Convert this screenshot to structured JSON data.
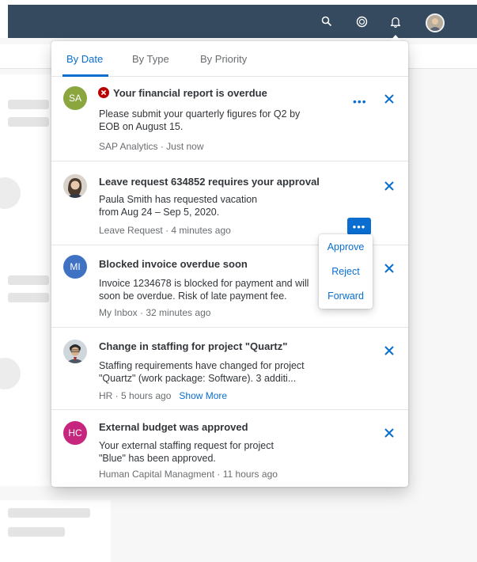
{
  "shellbar": {
    "icons": [
      "search-icon",
      "copilot-icon",
      "bell-icon"
    ],
    "background": "#354a5f"
  },
  "notifications": {
    "tabs": [
      {
        "label": "By Date",
        "active": true
      },
      {
        "label": "By Type",
        "active": false
      },
      {
        "label": "By Priority",
        "active": false
      }
    ],
    "items": [
      {
        "avatar_initials": "SA",
        "avatar_color": "#8ba53f",
        "error_icon": "error-icon",
        "title": "Your financial report is overdue",
        "body_lines": [
          "Please submit your quarterly figures for Q2 by",
          "EOB on August 15."
        ],
        "source": "SAP Analytics",
        "separator": " · ",
        "time": "Just now"
      },
      {
        "avatar_type": "photo",
        "title": "Leave request 634852 requires your approval",
        "body_lines": [
          "Paula Smith has requested vacation",
          "from Aug 24 – Sep 5, 2020."
        ],
        "source": "Leave Request",
        "separator": " · ",
        "time": "4 minutes ago",
        "menu": [
          "Approve",
          "Reject",
          "Forward"
        ]
      },
      {
        "avatar_initials": "MI",
        "avatar_color": "#3f72c2",
        "title": "Blocked invoice overdue soon",
        "body_lines": [
          "Invoice 1234678 is blocked for payment and will",
          "soon be overdue. Risk of late payment fee."
        ],
        "source": "My Inbox",
        "separator": " · ",
        "time": "32 minutes ago"
      },
      {
        "avatar_type": "photo",
        "title": "Change in staffing for project \"Quartz\"",
        "body_lines": [
          "Staffing requirements have changed for project",
          "\"Quartz\" (work package: Software). 3 additi..."
        ],
        "source": "HR",
        "separator": " · ",
        "time": "5 hours ago",
        "show_more": "Show More"
      },
      {
        "avatar_initials": "HC",
        "avatar_color": "#c7267e",
        "title": "External budget was approved",
        "body_lines": [
          "Your external staffing request for project",
          "\"Blue\" has been approved."
        ],
        "source": "Human Capital Managment",
        "separator": " · ",
        "time": "11 hours ago"
      }
    ]
  },
  "colors": {
    "accent": "#0a6ed1",
    "error": "#bb0000"
  }
}
